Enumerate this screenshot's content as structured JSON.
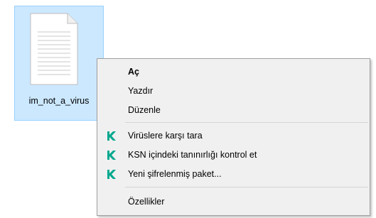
{
  "desktop": {
    "file": {
      "name": "im_not_a_virus",
      "icon": "text-document-icon"
    }
  },
  "context_menu": {
    "items": [
      {
        "label": "Aç",
        "bold": true
      },
      {
        "label": "Yazdır"
      },
      {
        "label": "Düzenle"
      },
      {
        "label": "Virüslere karşı tara",
        "icon": "kaspersky-k-icon"
      },
      {
        "label": "KSN içindeki tanınırlığı kontrol et",
        "icon": "kaspersky-k-icon"
      },
      {
        "label": "Yeni şifrelenmiş paket...",
        "icon": "kaspersky-k-icon"
      },
      {
        "label": "Özellikler"
      }
    ]
  },
  "colors": {
    "selection_bg": "#cce8ff",
    "selection_border": "#99d1ff",
    "menu_bg": "#f0f0f0",
    "kaspersky_green": "#00a88e"
  }
}
